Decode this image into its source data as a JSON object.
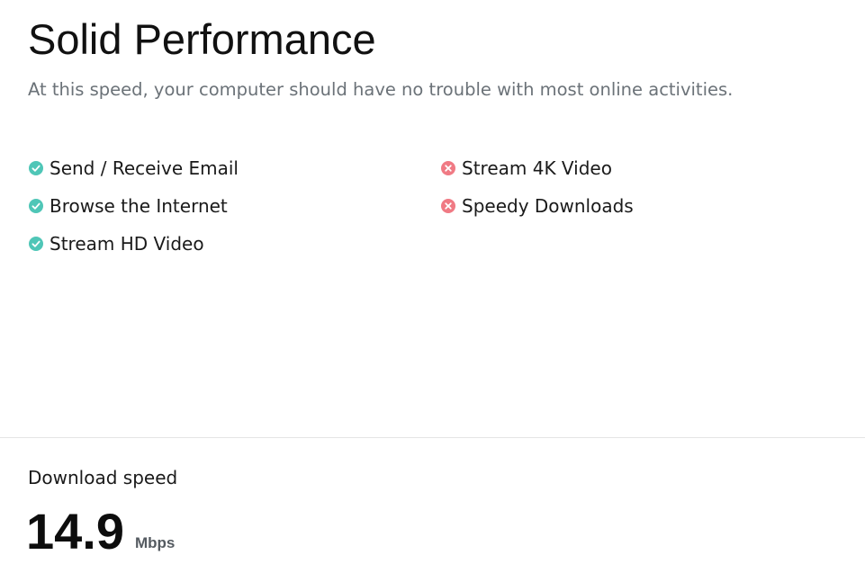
{
  "result": {
    "title": "Solid Performance",
    "subtitle": "At this speed, your computer should have no trouble with most online activities."
  },
  "features": {
    "supported": [
      {
        "label": "Send / Receive Email",
        "status": "check",
        "icon": "check-circle-icon"
      },
      {
        "label": "Browse the Internet",
        "status": "check",
        "icon": "check-circle-icon"
      },
      {
        "label": "Stream HD Video",
        "status": "check",
        "icon": "check-circle-icon"
      }
    ],
    "unsupported": [
      {
        "label": "Stream 4K Video",
        "status": "cross",
        "icon": "x-circle-icon"
      },
      {
        "label": "Speedy Downloads",
        "status": "cross",
        "icon": "x-circle-icon"
      }
    ]
  },
  "download": {
    "label": "Download speed",
    "value": "14.9",
    "unit": "Mbps"
  },
  "colors": {
    "check": "#4fc6b7",
    "cross": "#f07a84",
    "subtitle": "#6b7278",
    "divider": "#e5e5e5"
  }
}
